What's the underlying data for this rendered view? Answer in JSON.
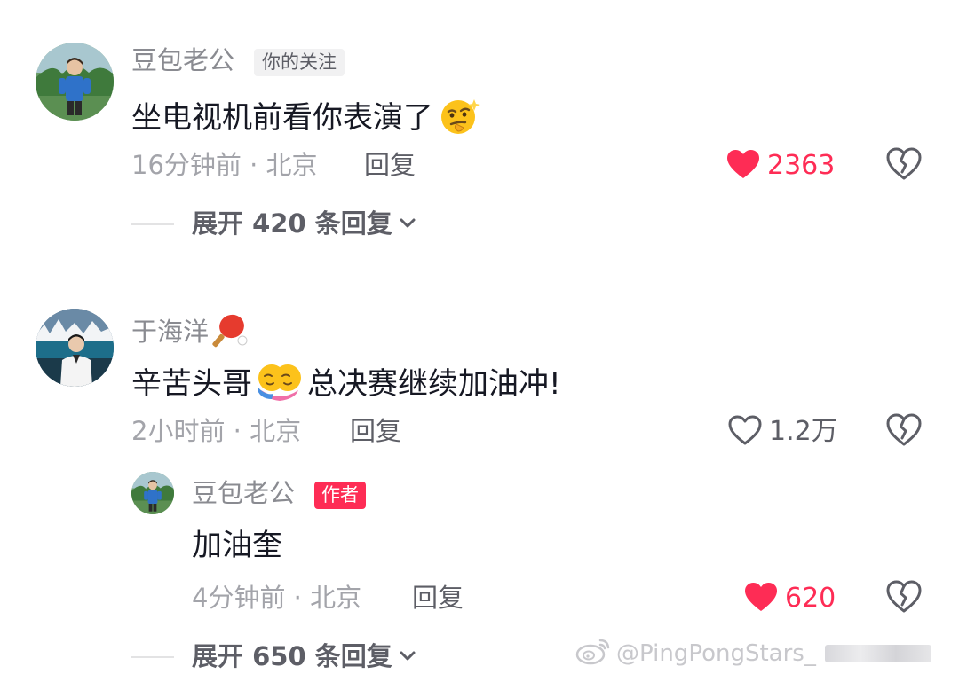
{
  "comments": [
    {
      "username": "豆包老公",
      "tag": "你的关注",
      "text": "坐电视机前看你表演了",
      "emoji": "smirk-thinking-emoji",
      "time": "16分钟前 · 北京",
      "reply_label": "回复",
      "likes": "2363",
      "liked": true,
      "expand_label": "展开 420 条回复"
    },
    {
      "username": "于海洋",
      "name_emoji": "ping-pong-paddle-emoji",
      "text_before": "辛苦头哥",
      "emoji": "hug-emoji",
      "text_after": "总决赛继续加油冲!",
      "time": "2小时前 · 北京",
      "reply_label": "回复",
      "likes": "1.2万",
      "liked": false
    }
  ],
  "reply": {
    "username": "豆包老公",
    "tag": "作者",
    "text": "加油奎",
    "time": "4分钟前 · 北京",
    "reply_label": "回复",
    "likes": "620",
    "liked": true,
    "expand_label": "展开 650 条回复"
  },
  "watermark": {
    "text": "@PingPongStars_",
    "icon": "weibo-icon"
  },
  "colors": {
    "accent": "#fe2c55",
    "muted": "#a3a4aa",
    "username": "#8a8b91",
    "text": "#161823"
  }
}
